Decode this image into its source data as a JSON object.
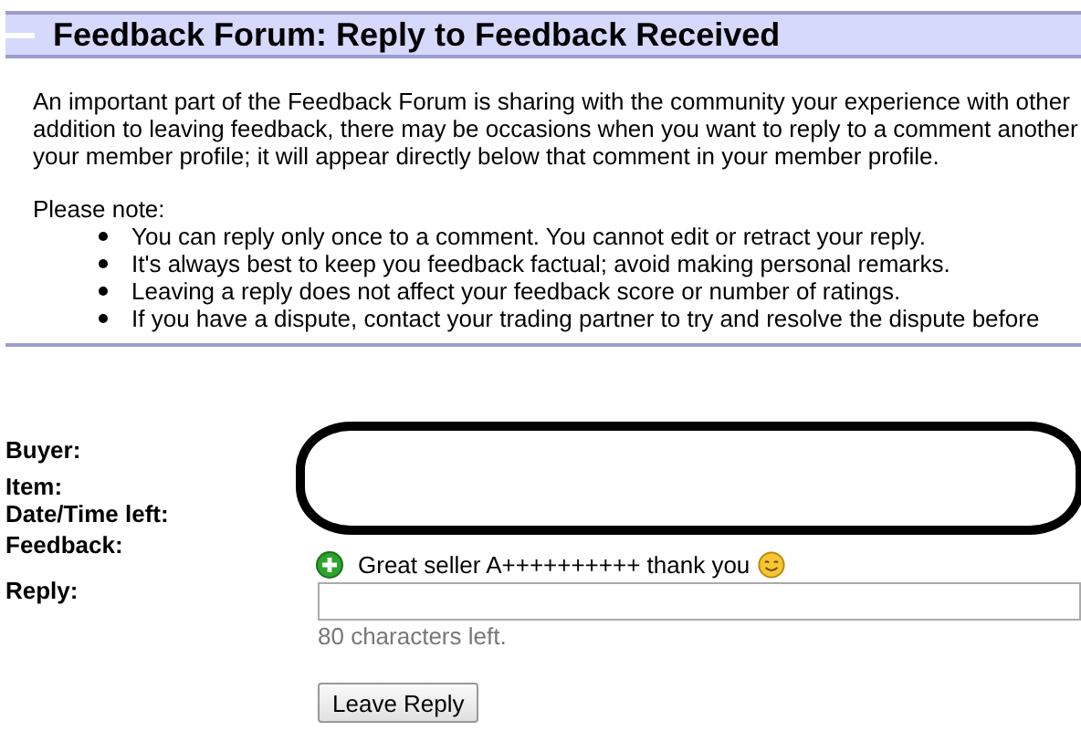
{
  "header": {
    "title": "Feedback Forum: Reply to Feedback Received"
  },
  "intro_lines": [
    "An important part of the Feedback Forum is sharing with the community your experience with other",
    "addition to leaving feedback, there may be occasions when you want to reply to a comment another",
    "your member profile; it will appear directly below that comment in your member profile."
  ],
  "note_heading": "Please note:",
  "notes": [
    "You can reply only once to a comment. You cannot edit or retract your reply.",
    "It's always best to keep you feedback factual; avoid making personal remarks.",
    "Leaving a reply does not affect your feedback score or number of ratings.",
    "If you have a dispute, contact your trading partner to try and resolve the dispute before"
  ],
  "form": {
    "labels": [
      "Buyer:",
      "Item:",
      "Date/Time left:",
      "Feedback:",
      "Reply:"
    ],
    "feedback": {
      "kind": "positive",
      "text": "Great seller A++++++++++ thank you"
    },
    "reply_counter": "80 characters left.",
    "button": "Leave Reply"
  }
}
